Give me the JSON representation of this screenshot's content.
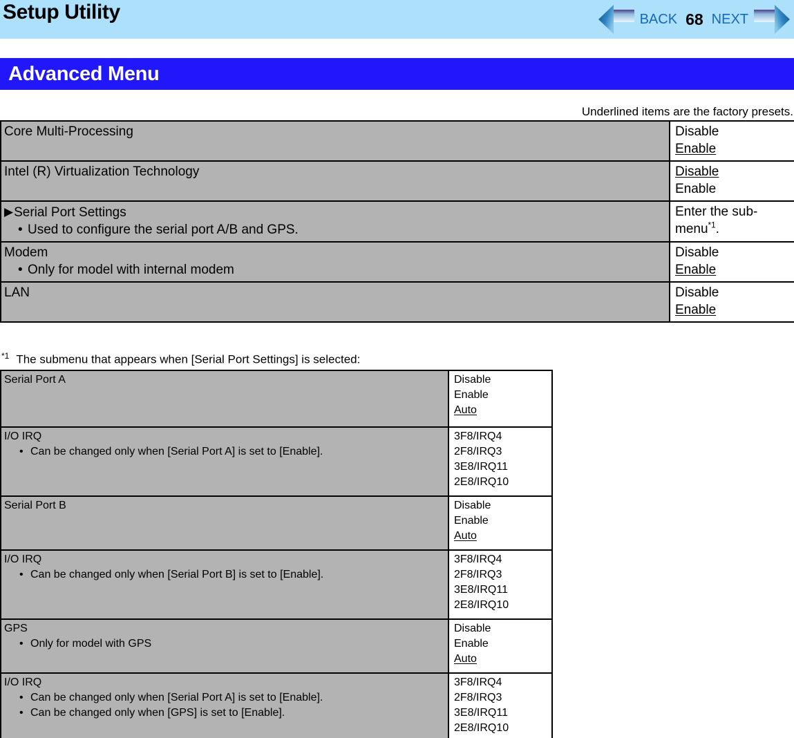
{
  "header": {
    "app_title": "Setup Utility",
    "back_label": "BACK",
    "page_number": "68",
    "next_label": "NEXT",
    "back_icon": "arrow-left-icon",
    "next_icon": "arrow-right-icon",
    "bg_color": "#ade0fb",
    "link_color": "#1569b8"
  },
  "section": {
    "title": "Advanced Menu",
    "bg_color": "#2018fa",
    "text_color": "#ffffff"
  },
  "preset_note": "Underlined items are the factory presets.",
  "colors": {
    "cell_gray": "#b3b3b3",
    "cell_white": "#ffffff",
    "border": "#000000"
  },
  "advanced_table": {
    "rows": [
      {
        "title": "Core Multi-Processing",
        "marker": "",
        "bullets": [],
        "options": [
          {
            "text": "Disable",
            "preset": false
          },
          {
            "text": "Enable",
            "preset": true
          }
        ]
      },
      {
        "title": "Intel (R) Virtualization Technology",
        "marker": "",
        "bullets": [],
        "options": [
          {
            "text": "Disable",
            "preset": true
          },
          {
            "text": "Enable",
            "preset": false
          }
        ]
      },
      {
        "title": "Serial Port Settings",
        "marker": "submenu-triangle",
        "bullets": [
          "Used to configure the serial port A/B and GPS."
        ],
        "options": [
          {
            "text": "Enter the sub-menu*1.",
            "preset": false,
            "footnote": "*1"
          }
        ]
      },
      {
        "title": "Modem",
        "marker": "",
        "bullets": [
          "Only for model with internal modem"
        ],
        "options": [
          {
            "text": "Disable",
            "preset": false
          },
          {
            "text": "Enable",
            "preset": true
          }
        ]
      },
      {
        "title": "LAN",
        "marker": "",
        "bullets": [],
        "options": [
          {
            "text": "Disable",
            "preset": false
          },
          {
            "text": "Enable",
            "preset": true
          }
        ]
      }
    ]
  },
  "footnote": {
    "mark": "*1",
    "text": "The submenu that appears when [Serial Port Settings] is selected:"
  },
  "submenu_table": {
    "rows": [
      {
        "title": "Serial Port A",
        "bullets": [],
        "options": [
          {
            "text": "Disable",
            "preset": false
          },
          {
            "text": "Enable",
            "preset": false
          },
          {
            "text": "Auto",
            "preset": true
          }
        ]
      },
      {
        "title": "I/O IRQ",
        "bullets": [
          "Can be changed only when [Serial Port A] is set to [Enable]."
        ],
        "options": [
          {
            "text": "3F8/IRQ4",
            "preset": false
          },
          {
            "text": "2F8/IRQ3",
            "preset": false
          },
          {
            "text": "3E8/IRQ11",
            "preset": false
          },
          {
            "text": "2E8/IRQ10",
            "preset": false
          }
        ]
      },
      {
        "title": "Serial Port B",
        "bullets": [],
        "options": [
          {
            "text": "Disable",
            "preset": false
          },
          {
            "text": "Enable",
            "preset": false
          },
          {
            "text": "Auto",
            "preset": true
          }
        ]
      },
      {
        "title": "I/O IRQ",
        "bullets": [
          "Can be changed only when [Serial Port B] is set to [Enable]."
        ],
        "options": [
          {
            "text": "3F8/IRQ4",
            "preset": false
          },
          {
            "text": "2F8/IRQ3",
            "preset": false
          },
          {
            "text": "3E8/IRQ11",
            "preset": false
          },
          {
            "text": "2E8/IRQ10",
            "preset": false
          }
        ]
      },
      {
        "title": "GPS",
        "bullets": [
          "Only for model with GPS"
        ],
        "options": [
          {
            "text": "Disable",
            "preset": false
          },
          {
            "text": "Enable",
            "preset": false
          },
          {
            "text": "Auto",
            "preset": true
          }
        ]
      },
      {
        "title": "I/O IRQ",
        "bullets": [
          "Can be changed only when [Serial Port A] is set to [Enable].",
          "Can be changed only when [GPS] is set to [Enable]."
        ],
        "options": [
          {
            "text": "3F8/IRQ4",
            "preset": false
          },
          {
            "text": "2F8/IRQ3",
            "preset": false
          },
          {
            "text": "3E8/IRQ11",
            "preset": false
          },
          {
            "text": "2E8/IRQ10",
            "preset": false
          }
        ]
      }
    ]
  }
}
